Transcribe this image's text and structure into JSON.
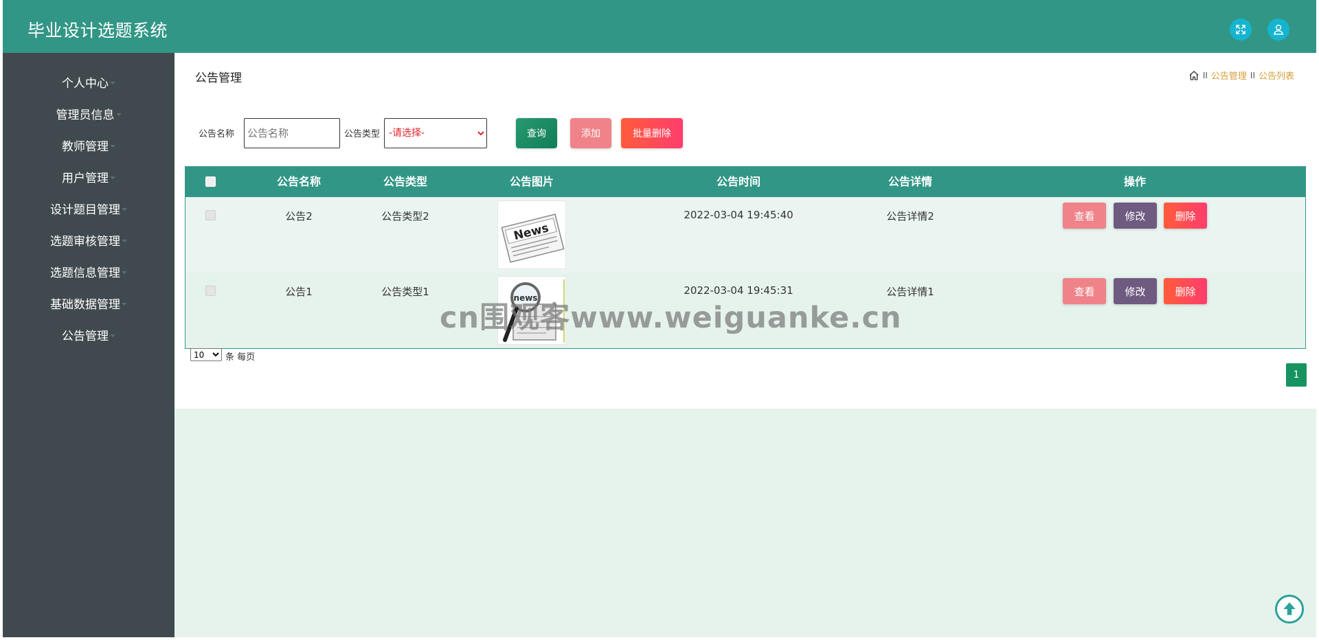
{
  "app": {
    "title": "毕业设计选题系统"
  },
  "header": {
    "fullscreen_icon": "fullscreen-icon",
    "user_icon": "user-icon"
  },
  "sidebar": {
    "items": [
      {
        "label": "个人中心"
      },
      {
        "label": "管理员信息"
      },
      {
        "label": "教师管理"
      },
      {
        "label": "用户管理"
      },
      {
        "label": "设计题目管理"
      },
      {
        "label": "选题审核管理"
      },
      {
        "label": "选题信息管理"
      },
      {
        "label": "基础数据管理"
      },
      {
        "label": "公告管理"
      }
    ]
  },
  "page": {
    "title": "公告管理",
    "breadcrumb": {
      "sep": "II",
      "level1": "公告管理",
      "level2": "公告列表"
    }
  },
  "search": {
    "name_label": "公告名称",
    "name_placeholder": "公告名称",
    "type_label": "公告类型",
    "type_selected": "-请选择-",
    "query_label": "查询",
    "add_label": "添加",
    "batch_delete_label": "批量删除"
  },
  "table": {
    "columns": [
      "公告名称",
      "公告类型",
      "公告图片",
      "公告时间",
      "公告详情",
      "操作"
    ],
    "rows": [
      {
        "name": "公告2",
        "type": "公告类型2",
        "time": "2022-03-04 19:45:40",
        "detail": "公告详情2",
        "image_text": "News"
      },
      {
        "name": "公告1",
        "type": "公告类型1",
        "time": "2022-03-04 19:45:31",
        "detail": "公告详情1",
        "image_text": "news"
      }
    ],
    "actions": {
      "view": "查看",
      "edit": "修改",
      "delete": "删除"
    }
  },
  "pagination": {
    "page_size": "10",
    "page_size_suffix": "条 每页",
    "current_page": "1"
  },
  "watermark": "cn围观客www.weiguanke.cn",
  "colors": {
    "header": "#329686",
    "sidebar": "#404a4e",
    "accent_green": "#16935f",
    "danger": "#ff4a55"
  }
}
